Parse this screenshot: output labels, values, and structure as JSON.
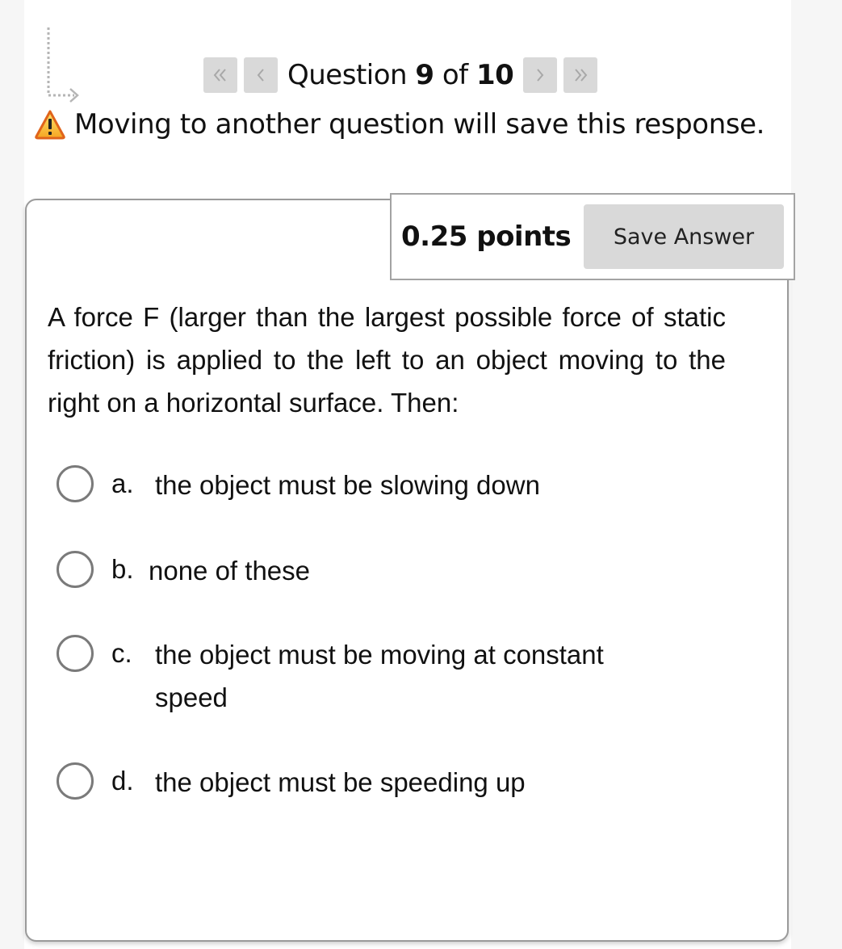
{
  "navigation": {
    "first_icon": "double-chevron-left-icon",
    "prev_icon": "chevron-left-icon",
    "next_icon": "chevron-right-icon",
    "last_icon": "double-chevron-right-icon",
    "label_prefix": "Question",
    "current": "9",
    "label_of": "of",
    "total": "10"
  },
  "warning": {
    "icon": "warning-triangle-icon",
    "text": "Moving to another question will save this response."
  },
  "question": {
    "points": "0.25 points",
    "save_label": "Save Answer",
    "text": "A force F (larger than the largest possible force of static friction) is applied to the left to an object moving to the right on a horizontal surface. Then:",
    "options": [
      {
        "letter": "a.",
        "text": "the object must be slowing down",
        "selected": false
      },
      {
        "letter": "b.",
        "text": "none of these",
        "selected": false
      },
      {
        "letter": "c.",
        "text": "the object must be moving at constant speed",
        "selected": false
      },
      {
        "letter": "d.",
        "text": "the object must be speeding up",
        "selected": false
      }
    ]
  }
}
